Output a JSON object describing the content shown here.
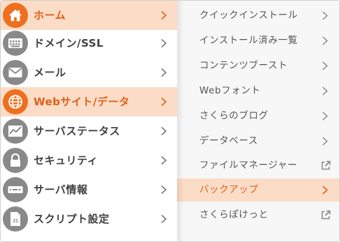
{
  "colors": {
    "accent": "#ee6f1f",
    "accent_text": "#e0601a",
    "active_bg": "#fbdcc6",
    "icon_gray": "#898989",
    "text": "#404040",
    "submenu_bg": "#f7f7f7"
  },
  "main_menu": {
    "items": [
      {
        "label": "ホーム",
        "icon": "home-icon",
        "active": true
      },
      {
        "label": "ドメイン/SSL",
        "icon": "keyboard-icon",
        "active": false
      },
      {
        "label": "メール",
        "icon": "envelope-icon",
        "active": false
      },
      {
        "label": "Webサイト/データ",
        "icon": "globe-icon",
        "active": true
      },
      {
        "label": "サーバステータス",
        "icon": "chart-icon",
        "active": false
      },
      {
        "label": "セキュリティ",
        "icon": "lock-icon",
        "active": false
      },
      {
        "label": "サーバ情報",
        "icon": "server-icon",
        "active": false
      },
      {
        "label": "スクリプト設定",
        "icon": "script-file-icon",
        "active": false
      }
    ]
  },
  "submenu": {
    "items": [
      {
        "label": "クイックインストール",
        "icon": "chevron-right-icon",
        "active": false
      },
      {
        "label": "インストール済み一覧",
        "icon": "chevron-right-icon",
        "active": false
      },
      {
        "label": "コンテンツブースト",
        "icon": "chevron-right-icon",
        "active": false
      },
      {
        "label": "Webフォント",
        "icon": "chevron-right-icon",
        "active": false
      },
      {
        "label": "さくらのブログ",
        "icon": "chevron-right-icon",
        "active": false
      },
      {
        "label": "データベース",
        "icon": "chevron-right-icon",
        "active": false
      },
      {
        "label": "ファイルマネージャー",
        "icon": "external-link-icon",
        "active": false
      },
      {
        "label": "バックアップ",
        "icon": "chevron-right-icon",
        "active": true
      },
      {
        "label": "さくらぽけっと",
        "icon": "external-link-icon",
        "active": false
      }
    ]
  }
}
